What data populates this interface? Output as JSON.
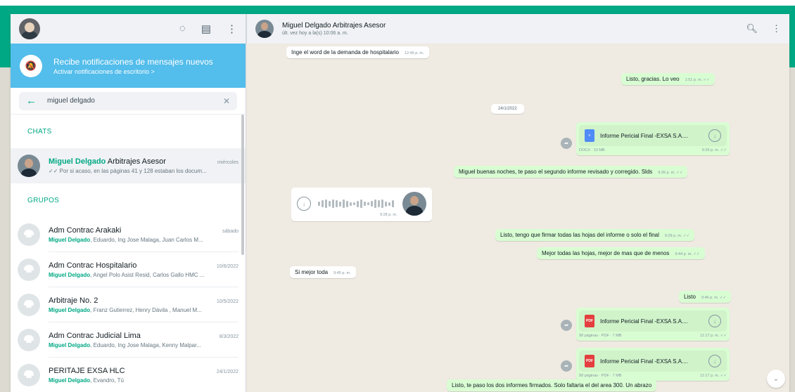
{
  "sidebar": {
    "header_icons": [
      "refresh-icon",
      "chat-icon",
      "menu-icon"
    ],
    "notification": {
      "title": "Recibe notificaciones de mensajes nuevos",
      "subtitle": "Activar notificaciones de escritorio >"
    },
    "search": {
      "value": "miguel delgado"
    },
    "chats_label": "CHATS",
    "groups_label": "GRUPOS",
    "chats": [
      {
        "name_highlight": "Miguel Delgado",
        "name_rest": " Arbitrajes Asesor",
        "time": "miércoles",
        "preview": "✓✓ Por si acaso, en las páginas 41 y 128 estaban los docum..."
      }
    ],
    "groups": [
      {
        "name": "Adm Contrac Arakaki",
        "time": "sábado",
        "sender": "Miguel Delgado",
        "preview": ", Eduardo, Ing Jose Malaga, Juan Carlos M..."
      },
      {
        "name": "Adm Contrac Hospitalario",
        "time": "10/6/2022",
        "sender": "Miguel Delgado",
        "preview": ", Angel Polo Asist Resid, Carlos Gallo HMC ..."
      },
      {
        "name": "Arbitraje No. 2",
        "time": "10/5/2022",
        "sender": "Miguel Delgado",
        "preview": ", Franz Gutierrez, Henry Dávila , Manuel M..."
      },
      {
        "name": "Adm Contrac Judicial Lima",
        "time": "8/3/2022",
        "sender": "Miguel Delgado",
        "preview": ", Eduardo, Ing Jose Malaga, Kenny Malpar..."
      },
      {
        "name": "PERITAJE EXSA HLC",
        "time": "24/1/2022",
        "sender": "Miguel Delgado",
        "preview": ", Evandro, Tú"
      }
    ]
  },
  "chat": {
    "contact_name": "Miguel Delgado Arbitrajes Asesor",
    "status": "últ. vez hoy a la(s) 10:06 a. m.",
    "header_icons": [
      "search-icon",
      "menu-icon"
    ],
    "date_divider": "24/1/2022",
    "messages": {
      "m1": {
        "text": "Inge el word de la demanda de hospitalario",
        "time": "12:46 p. m."
      },
      "m2": {
        "text": "Listo, gracias. Lo veo",
        "time": "1:51 p. m. ✓✓"
      },
      "file1": {
        "name": "Informe Pericial Final -EXSA S.A....",
        "meta": "DOCX · 10 MB",
        "time": "9:26 p. m. ✓✓"
      },
      "m3": {
        "text": "Miguel buenas noches, te paso el segundo informe revisado y corregido. Slds",
        "time": "9:26 p. m. ✓✓"
      },
      "voice": {
        "time": "9:28 p. m."
      },
      "m4": {
        "text": "Listo, tengo que firmar todas las hojas del informe o solo el final",
        "time": "9:29 p. m. ✓✓"
      },
      "m5": {
        "text": "Mejor todas las hojas, mejor de mas que de menos",
        "time": "9:44 p. m. ✓✓"
      },
      "m6": {
        "text": "Si mejor toda",
        "time": "9:45 p. m."
      },
      "m7": {
        "text": "Listo",
        "time": "9:46 p. m. ✓✓"
      },
      "file2": {
        "name": "Informe Pericial Final -EXSA S.A....",
        "meta": "99 páginas · PDF · 7 MB",
        "time": "11:17 p. m. ✓✓"
      },
      "file3": {
        "name": "Informe Pericial Final -EXSA S.A....",
        "meta": "99 páginas · PDF · 7 MB",
        "time": "11:17 p. m. ✓✓"
      },
      "m8": {
        "text": "Listo, te paso los dos informes firmados. Solo faltaria el del area 300. Un abrazo",
        "time": ""
      }
    }
  },
  "colors": {
    "accent": "#00a884",
    "notification": "#53bdeb",
    "outgoing": "#d9fdd3",
    "background": "#efeae2"
  }
}
